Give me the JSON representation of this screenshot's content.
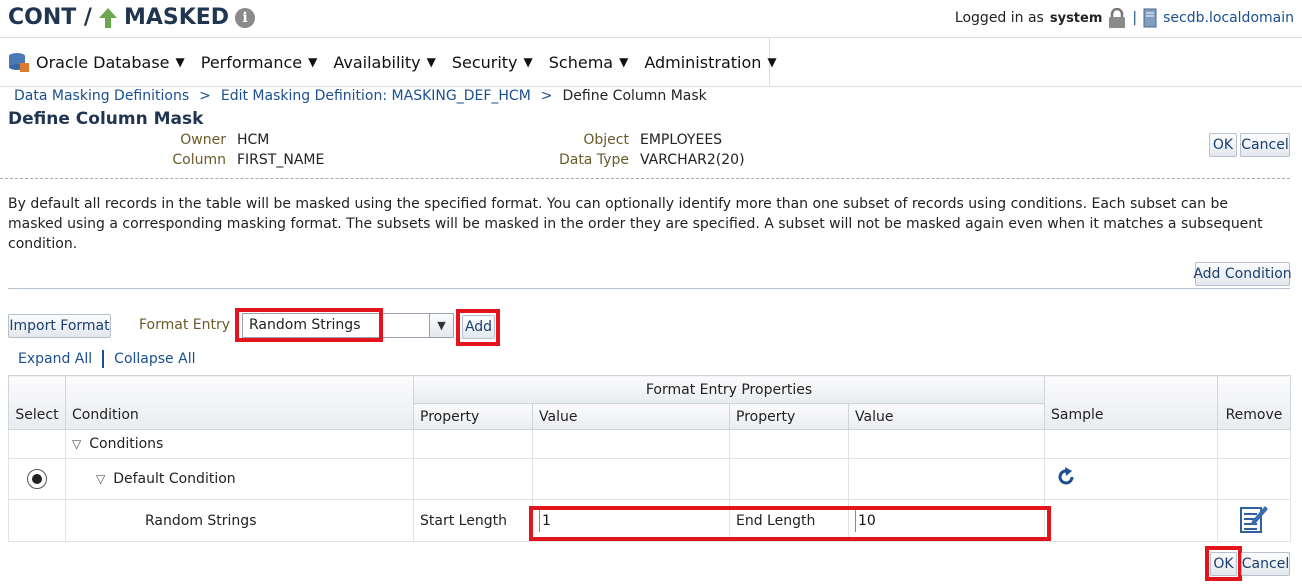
{
  "header": {
    "title_left": "CONT /",
    "title_right": "MASKED",
    "info_glyph": "i",
    "logged_in_label": "Logged in as",
    "user": "system",
    "separator": "|",
    "host": "secdb.localdomain"
  },
  "menu": [
    {
      "label": "Oracle Database"
    },
    {
      "label": "Performance"
    },
    {
      "label": "Availability"
    },
    {
      "label": "Security"
    },
    {
      "label": "Schema"
    },
    {
      "label": "Administration"
    }
  ],
  "breadcrumb": {
    "items": [
      "Data Masking Definitions",
      "Edit Masking Definition: MASKING_DEF_HCM",
      "Define Column Mask"
    ],
    "separator": ">"
  },
  "page_title": "Define Column Mask",
  "info": {
    "owner_label": "Owner",
    "owner": "HCM",
    "column_label": "Column",
    "column": "FIRST_NAME",
    "object_label": "Object",
    "object": "EMPLOYEES",
    "datatype_label": "Data Type",
    "datatype": "VARCHAR2(20)"
  },
  "buttons": {
    "ok": "OK",
    "cancel": "Cancel",
    "add_condition": "Add Condition",
    "import_format": "Import Format",
    "add": "Add"
  },
  "description": "By default all records in the table will be masked using the specified format. You can optionally identify more than one subset of records using conditions. Each subset can be masked using a corresponding masking format. The subsets will be masked in the order they are specified. A subset will not be masked again even when it matches a subsequent condition.",
  "format_entry": {
    "label": "Format Entry",
    "selected": "Random Strings"
  },
  "tree_controls": {
    "expand_all": "Expand All",
    "collapse_all": "Collapse All"
  },
  "table": {
    "group_header": "Format Entry Properties",
    "columns": {
      "select": "Select",
      "condition": "Condition",
      "property1": "Property",
      "value1": "Value",
      "property2": "Property",
      "value2": "Value",
      "sample": "Sample",
      "remove": "Remove"
    },
    "rows": {
      "conditions": "Conditions",
      "default_condition": "Default Condition",
      "entry": {
        "format": "Random Strings",
        "property1": "Start Length",
        "value1": "1",
        "property2": "End Length",
        "value2": "10"
      }
    }
  },
  "colors": {
    "highlight": "#e3141b",
    "link": "#1b4f8f",
    "title": "#1f3550",
    "label": "#6b5a2a"
  }
}
